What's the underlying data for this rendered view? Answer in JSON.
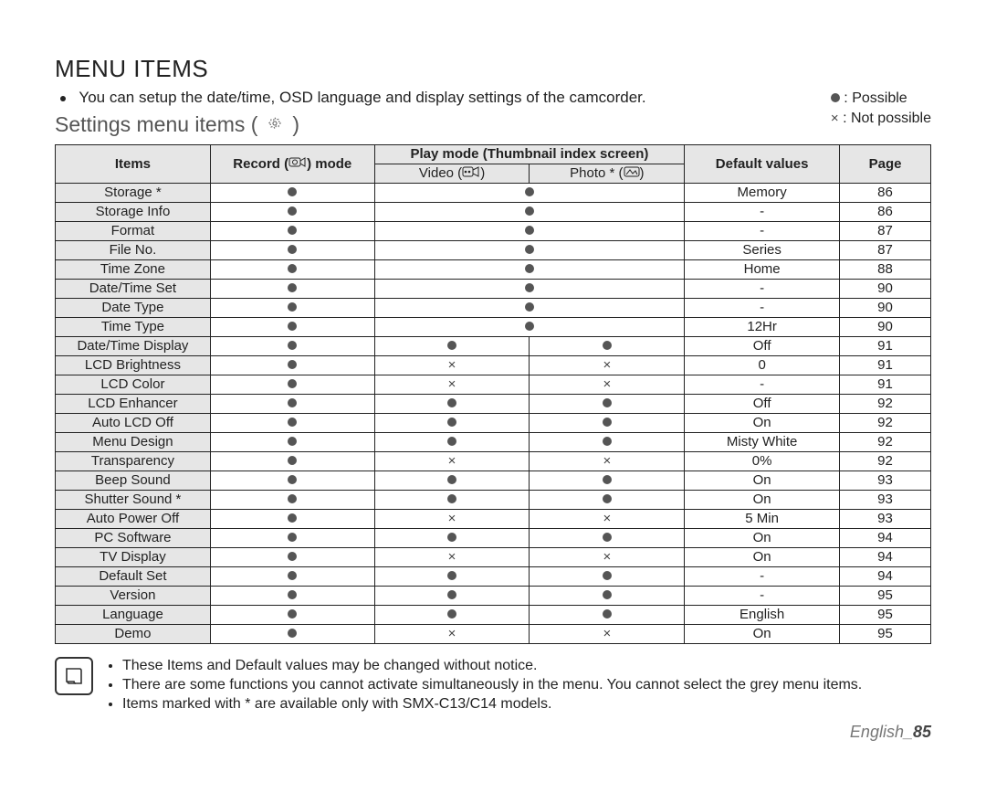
{
  "title": "MENU ITEMS",
  "intro": "You can setup the date/time, OSD language and display settings of the camcorder.",
  "subtitle_prefix": "Settings menu items (",
  "subtitle_suffix": ")",
  "legend": {
    "possible": ": Possible",
    "notpossible": ": Not possible"
  },
  "headers": {
    "items": "Items",
    "record": "Record (",
    "record_suffix": ") mode",
    "play_mode": "Play mode (Thumbnail index screen)",
    "video": "Video (",
    "video_suffix": ")",
    "photo": "Photo * (",
    "photo_suffix": ")",
    "default": "Default values",
    "page": "Page"
  },
  "chart_data": {
    "type": "table",
    "columns": [
      "Items",
      "Record mode",
      "Play mode Video",
      "Play mode Photo *",
      "Default values",
      "Page"
    ],
    "legend": {
      "●": "Possible",
      "×": "Not possible"
    },
    "rows": [
      {
        "item": "Storage *",
        "record": "●",
        "video": "●",
        "photo": "",
        "default": "Memory",
        "page": "86"
      },
      {
        "item": "Storage Info",
        "record": "●",
        "video": "●",
        "photo": "",
        "default": "-",
        "page": "86"
      },
      {
        "item": "Format",
        "record": "●",
        "video": "●",
        "photo": "",
        "default": "-",
        "page": "87"
      },
      {
        "item": "File No.",
        "record": "●",
        "video": "●",
        "photo": "",
        "default": "Series",
        "page": "87"
      },
      {
        "item": "Time Zone",
        "record": "●",
        "video": "●",
        "photo": "",
        "default": "Home",
        "page": "88"
      },
      {
        "item": "Date/Time Set",
        "record": "●",
        "video": "●",
        "photo": "",
        "default": "-",
        "page": "90"
      },
      {
        "item": "Date Type",
        "record": "●",
        "video": "●",
        "photo": "",
        "default": "-",
        "page": "90"
      },
      {
        "item": "Time Type",
        "record": "●",
        "video": "●",
        "photo": "",
        "default": "12Hr",
        "page": "90"
      },
      {
        "item": "Date/Time Display",
        "record": "●",
        "video": "●",
        "photo": "●",
        "default": "Off",
        "page": "91"
      },
      {
        "item": "LCD Brightness",
        "record": "●",
        "video": "×",
        "photo": "×",
        "default": "0",
        "page": "91"
      },
      {
        "item": "LCD Color",
        "record": "●",
        "video": "×",
        "photo": "×",
        "default": "-",
        "page": "91"
      },
      {
        "item": "LCD Enhancer",
        "record": "●",
        "video": "●",
        "photo": "●",
        "default": "Off",
        "page": "92"
      },
      {
        "item": "Auto LCD Off",
        "record": "●",
        "video": "●",
        "photo": "●",
        "default": "On",
        "page": "92"
      },
      {
        "item": "Menu Design",
        "record": "●",
        "video": "●",
        "photo": "●",
        "default": "Misty White",
        "page": "92"
      },
      {
        "item": "Transparency",
        "record": "●",
        "video": "×",
        "photo": "×",
        "default": "0%",
        "page": "92"
      },
      {
        "item": "Beep Sound",
        "record": "●",
        "video": "●",
        "photo": "●",
        "default": "On",
        "page": "93"
      },
      {
        "item": "Shutter Sound *",
        "record": "●",
        "video": "●",
        "photo": "●",
        "default": "On",
        "page": "93"
      },
      {
        "item": "Auto Power Off",
        "record": "●",
        "video": "×",
        "photo": "×",
        "default": "5 Min",
        "page": "93"
      },
      {
        "item": "PC Software",
        "record": "●",
        "video": "●",
        "photo": "●",
        "default": "On",
        "page": "94"
      },
      {
        "item": "TV Display",
        "record": "●",
        "video": "×",
        "photo": "×",
        "default": "On",
        "page": "94"
      },
      {
        "item": "Default Set",
        "record": "●",
        "video": "●",
        "photo": "●",
        "default": "-",
        "page": "94"
      },
      {
        "item": "Version",
        "record": "●",
        "video": "●",
        "photo": "●",
        "default": "-",
        "page": "95"
      },
      {
        "item": "Language",
        "record": "●",
        "video": "●",
        "photo": "●",
        "default": "English",
        "page": "95"
      },
      {
        "item": "Demo",
        "record": "●",
        "video": "×",
        "photo": "×",
        "default": "On",
        "page": "95"
      }
    ]
  },
  "footnotes": [
    "These Items and Default values may be changed without notice.",
    "There are some functions you cannot activate simultaneously in the menu. You cannot select the grey menu items.",
    "Items marked with * are available only with SMX-C13/C14 models."
  ],
  "footer_label": "English_",
  "footer_page": "85"
}
